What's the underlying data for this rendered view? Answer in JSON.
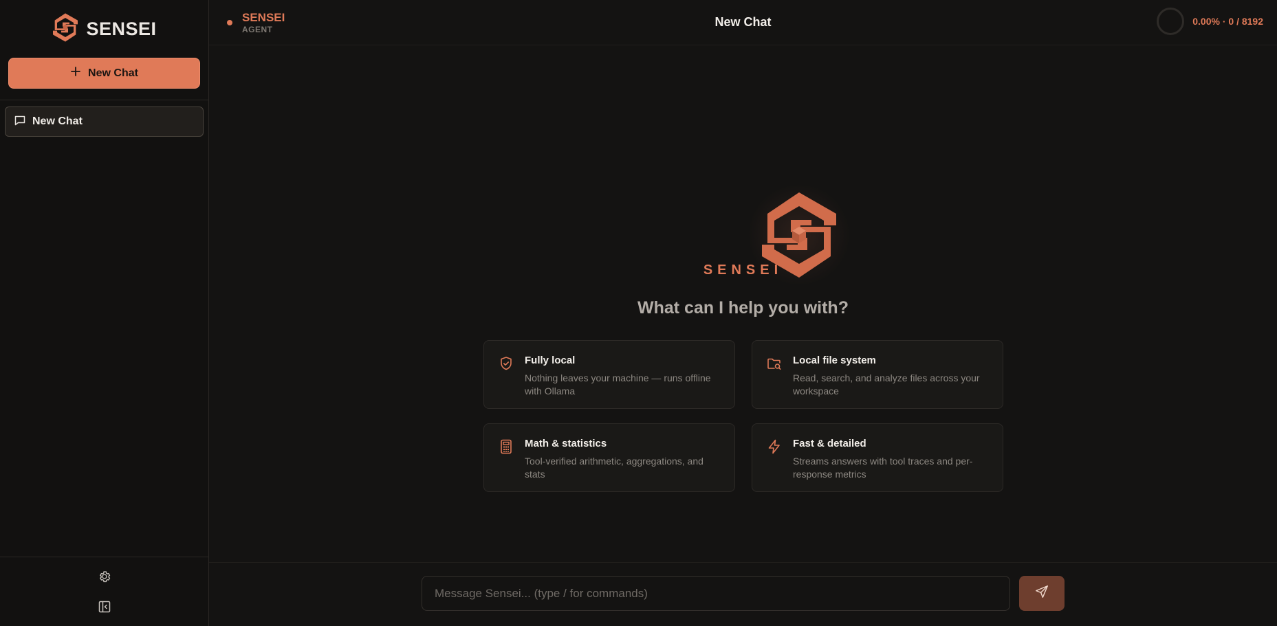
{
  "sidebar": {
    "brand": "SENSEI",
    "new_chat_label": "New Chat",
    "chats": [
      {
        "label": "New Chat",
        "active": true
      }
    ]
  },
  "topbar": {
    "agent_name": "SENSEI",
    "agent_role": "AGENT",
    "title": "New Chat",
    "token_usage": "0.00% · 0 / 8192"
  },
  "hero": {
    "name": "SENSEI",
    "question": "What can I help you with?"
  },
  "cards": [
    {
      "icon": "shield-check-icon",
      "title": "Fully local",
      "desc": "Nothing leaves your machine — runs offline with Ollama"
    },
    {
      "icon": "folder-search-icon",
      "title": "Local file system",
      "desc": "Read, search, and analyze files across your workspace"
    },
    {
      "icon": "calculator-icon",
      "title": "Math & statistics",
      "desc": "Tool-verified arithmetic, aggregations, and stats"
    },
    {
      "icon": "lightning-icon",
      "title": "Fast & detailed",
      "desc": "Streams answers with tool traces and per-response metrics"
    }
  ],
  "composer": {
    "placeholder": "Message Sensei... (type / for commands)",
    "value": ""
  },
  "colors": {
    "accent": "#e07a58",
    "background": "#141312",
    "sidebar": "#121110",
    "card": "#1a1917"
  }
}
